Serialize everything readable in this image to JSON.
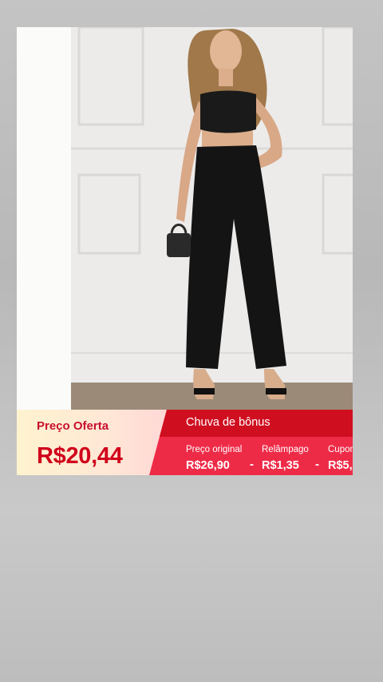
{
  "offer": {
    "label": "Preço Oferta",
    "price": "R$20,44"
  },
  "bonus": {
    "title": "Chuva de bônus",
    "items": [
      {
        "label": "Preço original",
        "value": "R$26,90"
      },
      {
        "label": "Relâmpago",
        "value": "R$1,35"
      },
      {
        "label": "Cupom",
        "value": "R$5,"
      }
    ],
    "separator": "-"
  },
  "colors": {
    "offer_text": "#d0021b",
    "bonus_bg": "#ee2b47",
    "bonus_header": "#cf0f20"
  },
  "product_image": {
    "icon": "product-photo-woman-black-crop-top-wide-leg-pants"
  }
}
